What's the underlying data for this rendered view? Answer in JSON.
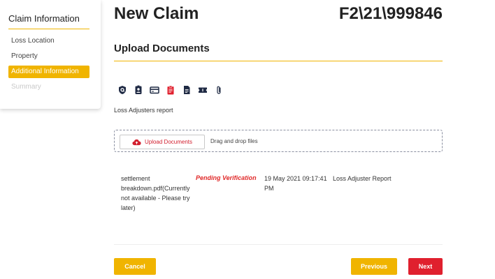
{
  "sidebar": {
    "title": "Claim Information",
    "items": [
      {
        "label": "Loss Location",
        "state": "normal"
      },
      {
        "label": "Property",
        "state": "normal"
      },
      {
        "label": "Additional Information",
        "state": "active"
      },
      {
        "label": "Summary",
        "state": "disabled"
      }
    ]
  },
  "header": {
    "title": "New Claim",
    "claim_number": "F2\\21\\999846"
  },
  "section": {
    "title": "Upload Documents"
  },
  "document_type_icons": [
    {
      "name": "shield-icon",
      "color": "#1f2a44"
    },
    {
      "name": "id-badge-icon",
      "color": "#1f2a44"
    },
    {
      "name": "credit-card-icon",
      "color": "#1f2a44"
    },
    {
      "name": "clipboard-icon",
      "color": "#e0202e",
      "selected": true
    },
    {
      "name": "document-icon",
      "color": "#1f2a44"
    },
    {
      "name": "ticket-icon",
      "color": "#1f2a44"
    },
    {
      "name": "paperclip-icon",
      "color": "#1f2a44"
    }
  ],
  "selected_document_type": "Loss Adjusters report",
  "upload": {
    "button_label": "Upload Documents",
    "drag_text": "Drag and drop files"
  },
  "files": [
    {
      "name": "settlement breakdown.pdf(Currently not available - Please try later)",
      "status": "Pending Verification",
      "date": "19 May 2021 09:17:41 PM",
      "type": "Loss Adjuster Report"
    }
  ],
  "actions": {
    "cancel": "Cancel",
    "previous": "Previous",
    "next": "Next"
  },
  "colors": {
    "accent": "#f0b400",
    "danger": "#e0202e",
    "icon": "#1f2a44"
  }
}
